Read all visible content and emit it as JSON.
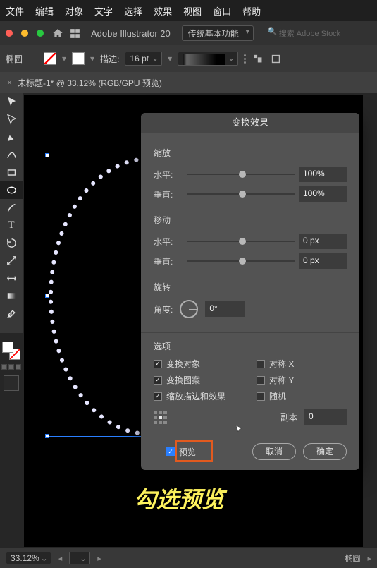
{
  "menus": [
    "文件",
    "编辑",
    "对象",
    "文字",
    "选择",
    "效果",
    "视图",
    "窗口",
    "帮助"
  ],
  "app_name": "Adobe Illustrator 20",
  "workspace": "传统基本功能",
  "stock_search": "搜索 Adobe Stock",
  "ctrl": {
    "shape": "椭圆",
    "stroke_label": "描边:",
    "stroke_val": "16 pt"
  },
  "doc_tab": "未标题-1* @ 33.12% (RGB/GPU 预览)",
  "dialog": {
    "title": "变换效果",
    "scale": {
      "title": "缩放",
      "h_label": "水平:",
      "h_val": "100%",
      "v_label": "垂直:",
      "v_val": "100%"
    },
    "move": {
      "title": "移动",
      "h_label": "水平:",
      "h_val": "0 px",
      "v_label": "垂直:",
      "v_val": "0 px"
    },
    "rotate": {
      "title": "旋转",
      "angle_label": "角度:",
      "angle_val": "0°"
    },
    "options": {
      "title": "选项",
      "obj": "变换对象",
      "pat": "变换图案",
      "strokefx": "缩放描边和效果",
      "reflx": "对称 X",
      "refly": "对称 Y",
      "rand": "随机"
    },
    "copies": {
      "label": "副本",
      "val": "0"
    },
    "preview": "预览",
    "cancel": "取消",
    "ok": "确定"
  },
  "annotation": "勾选预览",
  "status": {
    "zoom": "33.12%",
    "shape": "椭圆"
  }
}
